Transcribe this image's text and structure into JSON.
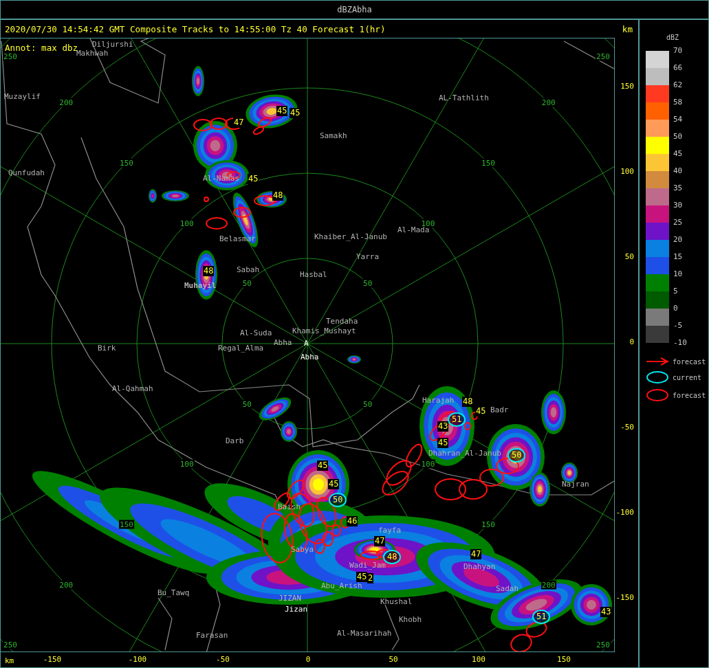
{
  "window": {
    "title": "dBZAbha"
  },
  "header": {
    "text": "2020/07/30 14:54:42 GMT Composite Tracks to 14:55:00 Tz 40 Forecast 1(hr)",
    "units": "km"
  },
  "map": {
    "annotation": "Annot: max dbz",
    "range_labels": [
      "50",
      "50",
      "50",
      "50",
      "100",
      "100",
      "100",
      "100",
      "150",
      "150",
      "150",
      "150",
      "200",
      "200",
      "200",
      "200",
      "250",
      "250",
      "250",
      "250"
    ],
    "places": [
      {
        "name": "Diljurshi",
        "kind": "label"
      },
      {
        "name": "Makhwah",
        "kind": "label"
      },
      {
        "name": "Muzaylif",
        "kind": "label"
      },
      {
        "name": "Qunfudah",
        "kind": "label"
      },
      {
        "name": "Al-Namas",
        "kind": "label"
      },
      {
        "name": "Belasmar",
        "kind": "label"
      },
      {
        "name": "Sabah",
        "kind": "label"
      },
      {
        "name": "Muhayil",
        "kind": "bold"
      },
      {
        "name": "Samakh",
        "kind": "label"
      },
      {
        "name": "AL-Tathlith",
        "kind": "label"
      },
      {
        "name": "Khaiber_Al-Janub",
        "kind": "label"
      },
      {
        "name": "Al-Mada",
        "kind": "label"
      },
      {
        "name": "Yarra",
        "kind": "label"
      },
      {
        "name": "Hasbal",
        "kind": "label"
      },
      {
        "name": "Tendaha",
        "kind": "label"
      },
      {
        "name": "Al-Suda",
        "kind": "label"
      },
      {
        "name": "Khamis_Mushayt",
        "kind": "label"
      },
      {
        "name": "Abha",
        "kind": "label"
      },
      {
        "name": "Regal_Alma",
        "kind": "label"
      },
      {
        "name": "A",
        "kind": "highlight"
      },
      {
        "name": "Abha",
        "kind": "highlight"
      },
      {
        "name": "Birk",
        "kind": "label"
      },
      {
        "name": "Al-Qahmah",
        "kind": "label"
      },
      {
        "name": "Darb",
        "kind": "label"
      },
      {
        "name": "Baish",
        "kind": "label"
      },
      {
        "name": "Sabya",
        "kind": "label"
      },
      {
        "name": "fayfa",
        "kind": "label"
      },
      {
        "name": "Wadi_Jam",
        "kind": "label"
      },
      {
        "name": "Abu_Arish",
        "kind": "label"
      },
      {
        "name": "JIZAN",
        "kind": "label"
      },
      {
        "name": "Jizan",
        "kind": "highlight"
      },
      {
        "name": "Khushal",
        "kind": "label"
      },
      {
        "name": "Khobh",
        "kind": "label"
      },
      {
        "name": "Al-Masarihah",
        "kind": "label"
      },
      {
        "name": "Bu_Tawq",
        "kind": "label"
      },
      {
        "name": "Farasan",
        "kind": "label"
      },
      {
        "name": "Harajah",
        "kind": "label"
      },
      {
        "name": "Badr",
        "kind": "label"
      },
      {
        "name": "Dhahran_Al-Janub",
        "kind": "label"
      },
      {
        "name": "Najran",
        "kind": "label"
      },
      {
        "name": "Dhahyan",
        "kind": "label"
      },
      {
        "name": "Sadah",
        "kind": "label"
      }
    ],
    "cells": [
      {
        "value": "45",
        "current": false
      },
      {
        "value": "45",
        "current": false
      },
      {
        "value": "47",
        "current": false
      },
      {
        "value": "45",
        "current": false
      },
      {
        "value": "48",
        "current": false
      },
      {
        "value": "48",
        "current": false
      },
      {
        "value": "45",
        "current": false
      },
      {
        "value": "45",
        "current": false
      },
      {
        "value": "50",
        "current": true
      },
      {
        "value": "46",
        "current": false
      },
      {
        "value": "47",
        "current": false
      },
      {
        "value": "48",
        "current": true
      },
      {
        "value": "45",
        "current": false
      },
      {
        "value": "2",
        "current": false
      },
      {
        "value": "48",
        "current": false
      },
      {
        "value": "51",
        "current": true
      },
      {
        "value": "45",
        "current": false
      },
      {
        "value": "43",
        "current": false
      },
      {
        "value": "45",
        "current": false
      },
      {
        "value": "50",
        "current": true
      },
      {
        "value": "47",
        "current": false
      },
      {
        "value": "51",
        "current": true
      },
      {
        "value": "43",
        "current": false
      }
    ]
  },
  "x_axis": {
    "unit": "km",
    "ticks": [
      "-150",
      "-100",
      "-50",
      "0",
      "50",
      "100",
      "150"
    ]
  },
  "y_axis": {
    "ticks": [
      "150",
      "100",
      "50",
      "0",
      "-50",
      "-100",
      "-150"
    ]
  },
  "legend": {
    "title": "dBZ",
    "steps": [
      {
        "label": "70",
        "color": "#d4d4d4"
      },
      {
        "label": "66",
        "color": "#bdbdbd"
      },
      {
        "label": "62",
        "color": "#ff3a20"
      },
      {
        "label": "58",
        "color": "#ff6000"
      },
      {
        "label": "54",
        "color": "#ff9a58"
      },
      {
        "label": "50",
        "color": "#ffff00"
      },
      {
        "label": "45",
        "color": "#fcc535"
      },
      {
        "label": "40",
        "color": "#d18a3e"
      },
      {
        "label": "35",
        "color": "#be6a8a"
      },
      {
        "label": "30",
        "color": "#c8137f"
      },
      {
        "label": "25",
        "color": "#6e13c8"
      },
      {
        "label": "20",
        "color": "#0a80e0"
      },
      {
        "label": "15",
        "color": "#1e50e8"
      },
      {
        "label": "10",
        "color": "#008000"
      },
      {
        "label": "5",
        "color": "#005a00"
      },
      {
        "label": "0",
        "color": "#7a7a7a"
      },
      {
        "label": "-5",
        "color": "#3a3a3a"
      }
    ],
    "last_label": "-10",
    "keys": [
      {
        "kind": "arrow",
        "label": "forecast"
      },
      {
        "kind": "current",
        "label": "current"
      },
      {
        "kind": "forecast",
        "label": "forecast"
      }
    ]
  }
}
